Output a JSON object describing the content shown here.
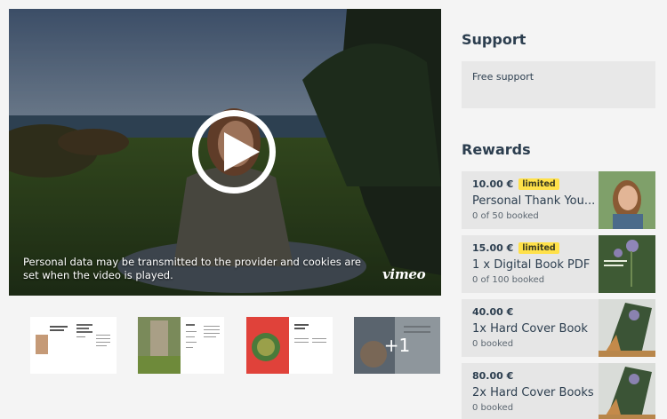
{
  "video": {
    "privacy_notice": "Personal data may be transmitted to the provider and cookies are set when the video is played.",
    "provider_logo": "vimeo"
  },
  "thumbnails": {
    "more_count": "+1"
  },
  "support": {
    "heading": "Support",
    "free_support_label": "Free support"
  },
  "rewards": {
    "heading": "Rewards",
    "items": [
      {
        "price": "10.00 €",
        "badge": "limited",
        "title": "Personal Thank You...",
        "booked": "0 of 50 booked"
      },
      {
        "price": "15.00 €",
        "badge": "limited",
        "title": "1 x Digital Book PDF",
        "booked": "0 of 100 booked"
      },
      {
        "price": "40.00 €",
        "badge": "",
        "title": "1x Hard Cover Book",
        "booked": "0 booked"
      },
      {
        "price": "80.00 €",
        "badge": "",
        "title": "2x Hard Cover Books",
        "booked": "0 booked"
      }
    ]
  },
  "colors": {
    "badge": "#ffe14a",
    "card": "#e6e6e6",
    "heading": "#2c3e4f"
  }
}
